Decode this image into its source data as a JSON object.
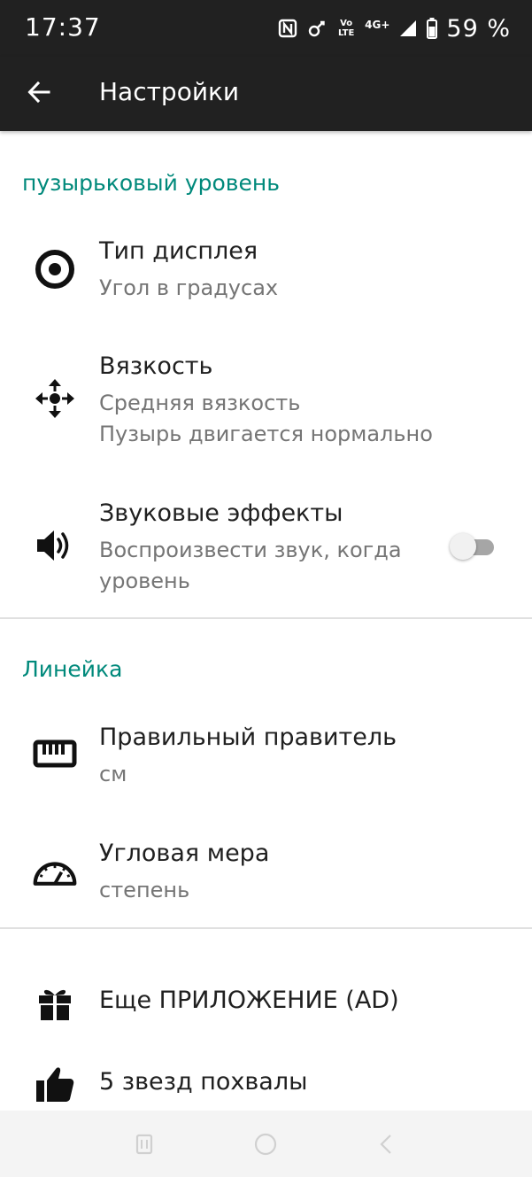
{
  "status_bar": {
    "time": "17:37",
    "network_label": "Vo LTE",
    "network_type": "4G+",
    "battery": "59 %",
    "icons": [
      "nfc-icon",
      "link-icon",
      "volte-icon",
      "signal-icon",
      "battery-icon"
    ]
  },
  "app_bar": {
    "title": "Настройки",
    "back_icon": "arrow-left-icon"
  },
  "sections": {
    "level": {
      "header": "пузырьковый уровень",
      "display_type": {
        "title": "Тип дисплея",
        "summary": "Угол в градусах",
        "icon": "target-icon"
      },
      "viscosity": {
        "title": "Вязкость",
        "summary_line1": "Средняя вязкость",
        "summary_line2": "Пузырь двигается нормально",
        "icon": "move-arrows-icon"
      },
      "sound": {
        "title": "Звуковые эффекты",
        "summary_line1": "Воспроизвести звук, когда",
        "summary_line2": "уровень",
        "enabled": false,
        "icon": "speaker-icon"
      }
    },
    "ruler": {
      "header": "Линейка",
      "ruler_unit": {
        "title": "Правильный правитель",
        "summary": "см",
        "icon": "ruler-icon"
      },
      "angle_unit": {
        "title": "Угловая мера",
        "summary": "степень",
        "icon": "protractor-icon"
      }
    },
    "extra": {
      "more_apps": {
        "title": "Еще ПРИЛОЖЕНИЕ (AD)",
        "icon": "gift-icon"
      },
      "rate": {
        "title": "5 звезд похвалы",
        "icon": "thumbs-up-icon"
      }
    }
  },
  "colors": {
    "accent": "#00897b",
    "app_bar": "#212121",
    "title_text": "#202020",
    "summary_text": "#757575"
  },
  "nav_bar": {
    "icons": [
      "recents-icon",
      "home-icon",
      "back-icon"
    ]
  }
}
